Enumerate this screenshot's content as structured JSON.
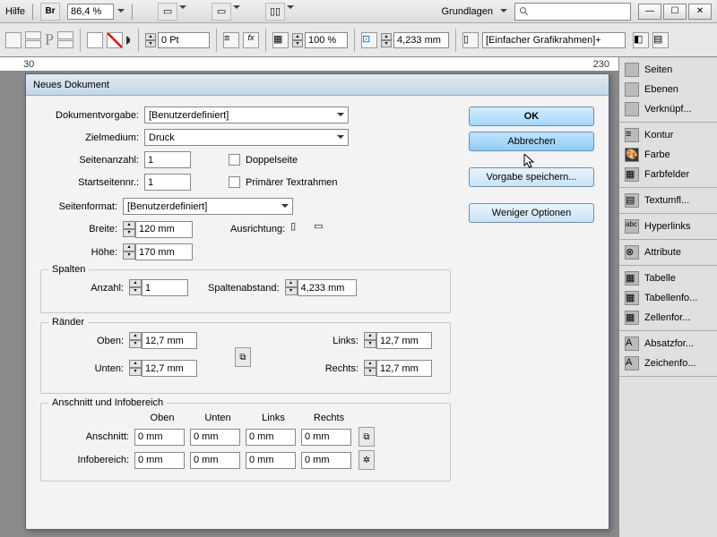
{
  "menubar": {
    "help": "Hilfe",
    "br": "Br",
    "zoom": "86,4 %",
    "basics": "Grundlagen"
  },
  "ctrlbar": {
    "pt": "0 Pt",
    "pct": "100 %",
    "mm": "4,233 mm",
    "frameStyle": "[Einfacher Grafikrahmen]+"
  },
  "ruler": {
    "tick1": "30",
    "tick2": "230"
  },
  "rightpanel": {
    "seiten": "Seiten",
    "ebenen": "Ebenen",
    "verkn": "Verknüpf...",
    "kontur": "Kontur",
    "farbe": "Farbe",
    "farbfelder": "Farbfelder",
    "textumfl": "Textumfl...",
    "hyperlinks": "Hyperlinks",
    "attribute": "Attribute",
    "tabelle": "Tabelle",
    "tabellenfo": "Tabellenfo...",
    "zellenfor": "Zellenfor...",
    "absatzfor": "Absatzfor...",
    "zeichenfo": "Zeichenfo..."
  },
  "dialog": {
    "title": "Neues Dokument",
    "ok": "OK",
    "cancel": "Abbrechen",
    "savePreset": "Vorgabe speichern...",
    "lessOptions": "Weniger Optionen",
    "docPresetLabel": "Dokumentvorgabe:",
    "docPreset": "[Benutzerdefiniert]",
    "intentLabel": "Zielmedium:",
    "intent": "Druck",
    "pagesLabel": "Seitenanzahl:",
    "pages": "1",
    "facingLabel": "Doppelseite",
    "startPageLabel": "Startseitennr.:",
    "startPage": "1",
    "primaryFrame": "Primärer Textrahmen",
    "pageSizeLabel": "Seitenformat:",
    "pageSize": "[Benutzerdefiniert]",
    "widthLabel": "Breite:",
    "width": "120 mm",
    "heightLabel": "Höhe:",
    "height": "170 mm",
    "orientLabel": "Ausrichtung:",
    "columnsLegend": "Spalten",
    "colCountLabel": "Anzahl:",
    "colCount": "1",
    "gutterLabel": "Spaltenabstand:",
    "gutter": "4,233 mm",
    "marginsLegend": "Ränder",
    "topLabel": "Oben:",
    "bottomLabel": "Unten:",
    "leftLabel": "Links:",
    "rightLabel": "Rechts:",
    "marginTop": "12,7 mm",
    "marginBottom": "12,7 mm",
    "marginLeft": "12,7 mm",
    "marginRight": "12,7 mm",
    "bleedLegend": "Anschnitt und Infobereich",
    "hdrTop": "Oben",
    "hdrBottom": "Unten",
    "hdrLeft": "Links",
    "hdrRight": "Rechts",
    "bleedLabel": "Anschnitt:",
    "slugLabel": "Infobereich:",
    "zero": "0 mm"
  }
}
